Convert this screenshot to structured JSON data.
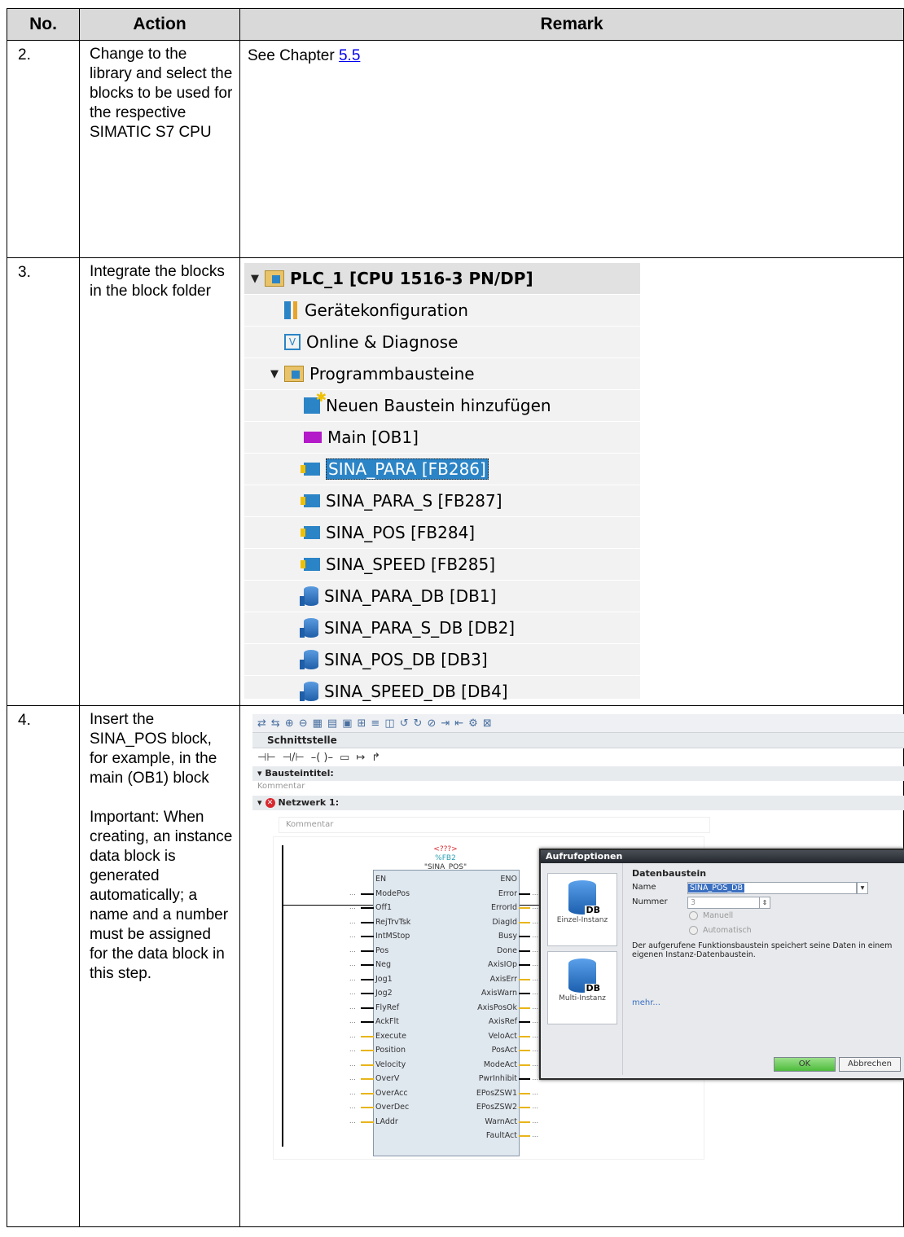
{
  "headers": {
    "no": "No.",
    "action": "Action",
    "remark": "Remark"
  },
  "rows": [
    {
      "no": "2.",
      "action": "Change to the library and select the blocks to be used for the respective SIMATIC S7 CPU",
      "remark_prefix": "See Chapter",
      "remark_link": "5.5"
    },
    {
      "no": "3.",
      "action": "Integrate the blocks in the block folder"
    },
    {
      "no": "4.",
      "action": "Insert the SINA_POS block, for example, in the main (OB1) block",
      "action_note": "Important: When creating, an instance data block is generated automatically; a name and a number must be assigned for the data block in this step."
    }
  ],
  "tree": {
    "items": [
      {
        "label": "PLC_1 [CPU 1516-3 PN/DP]",
        "icon": "plc-folder-icon",
        "level": 0,
        "twisty": "▼"
      },
      {
        "label": "Gerätekonfiguration",
        "icon": "device-config-icon",
        "level": 1
      },
      {
        "label": "Online & Diagnose",
        "icon": "online-diagnostics-icon",
        "level": 1
      },
      {
        "label": "Programmbausteine",
        "icon": "program-blocks-folder-icon",
        "level": 1,
        "twisty": "▼"
      },
      {
        "label": "Neuen Baustein hinzufügen",
        "icon": "add-block-icon",
        "level": 2
      },
      {
        "label": "Main [OB1]",
        "icon": "ob-block-icon",
        "level": 2
      },
      {
        "label": "SINA_PARA [FB286]",
        "icon": "fb-block-icon",
        "level": 2,
        "selected": true
      },
      {
        "label": "SINA_PARA_S [FB287]",
        "icon": "fb-block-icon",
        "level": 2
      },
      {
        "label": "SINA_POS [FB284]",
        "icon": "fb-block-icon",
        "level": 2
      },
      {
        "label": "SINA_SPEED [FB285]",
        "icon": "fb-block-icon",
        "level": 2
      },
      {
        "label": "SINA_PARA_DB [DB1]",
        "icon": "db-block-icon",
        "level": 2
      },
      {
        "label": "SINA_PARA_S_DB [DB2]",
        "icon": "db-block-icon",
        "level": 2
      },
      {
        "label": "SINA_POS_DB [DB3]",
        "icon": "db-block-icon",
        "level": 2
      },
      {
        "label": "SINA_SPEED_DB [DB4]",
        "icon": "db-block-icon",
        "level": 2
      }
    ]
  },
  "editor": {
    "interface_label": "Schnittstelle",
    "block_title": "Bausteintitel:",
    "comment": "Kommentar",
    "network_title": "Netzwerk 1:",
    "fb": {
      "instance": "<???>",
      "number": "%FB2",
      "name": "\"SINA_POS\"",
      "inputs": [
        "EN",
        "ModePos",
        "Off1",
        "RejTrvTsk",
        "IntMStop",
        "Pos",
        "Neg",
        "Jog1",
        "Jog2",
        "FlyRef",
        "AckFlt",
        "Execute",
        "Position",
        "Velocity",
        "OverV",
        "OverAcc",
        "OverDec",
        "LAddr"
      ],
      "outputs": [
        "ENO",
        "Error",
        "ErrorId",
        "DiagId",
        "Busy",
        "Done",
        "AxisIOp",
        "AxisErr",
        "AxisWarn",
        "AxisPosOk",
        "AxisRef",
        "VeloAct",
        "PosAct",
        "ModeAct",
        "PwrInhibit",
        "EPosZSW1",
        "EPosZSW2",
        "WarnAct",
        "FaultAct"
      ],
      "dots": "..."
    },
    "dialog": {
      "title": "Aufrufoptionen",
      "section": "Datenbaustein",
      "name_label": "Name",
      "name_value": "SINA_POS_DB",
      "number_label": "Nummer",
      "number_value": "3",
      "radio_manual": "Manuell",
      "radio_auto": "Automatisch",
      "description": "Der aufgerufene Funktionsbaustein speichert seine Daten in einem eigenen Instanz-Datenbaustein.",
      "more_link": "mehr...",
      "single_instance": "Einzel-Instanz",
      "multi_instance": "Multi-Instanz",
      "db_badge": "DB",
      "ok": "OK",
      "cancel": "Abbrechen"
    }
  }
}
